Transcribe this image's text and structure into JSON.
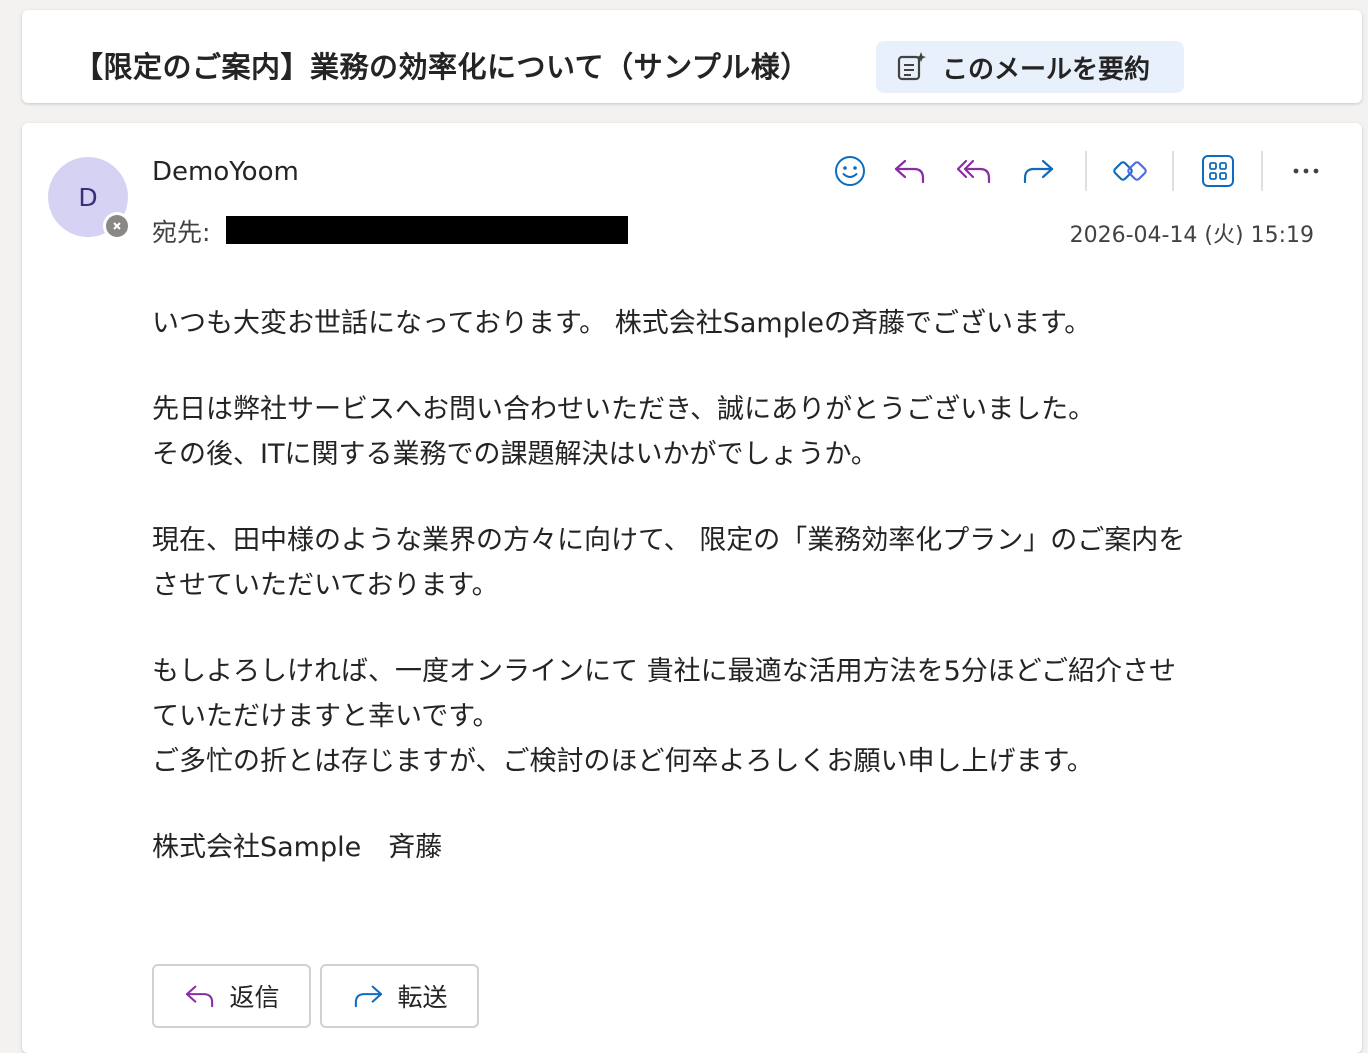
{
  "subject": {
    "title": "【限定のご案内】業務の効率化について（サンプル様）",
    "summarize_label": "このメールを要約"
  },
  "message": {
    "avatar_initial": "D",
    "sender": "DemoYoom",
    "to_label": "宛先:",
    "date": "2026-04-14 (火) 15:19",
    "body": [
      [
        "いつも大変お世話になっております。 株式会社Sampleの斉藤でございます。"
      ],
      [
        "先日は弊社サービスへお問い合わせいただき、誠にありがとうございました。",
        "その後、ITに関する業務での課題解決はいかがでしょうか。"
      ],
      [
        "現在、田中様のような業界の方々に向けて、 限定の「業務効率化プラン」のご案内を",
        "させていただいております。"
      ],
      [
        "もしよろしければ、一度オンラインにて 貴社に最適な活用方法を5分ほどご紹介させ",
        "ていただけますと幸いです。",
        "ご多忙の折とは存じますが、ご検討のほど何卒よろしくお願い申し上げます。"
      ],
      [
        "株式会社Sample　斉藤"
      ]
    ]
  },
  "toolbar": {
    "icons": [
      "emoji-icon",
      "reply-icon",
      "reply-all-icon",
      "forward-icon",
      "copilot-icon",
      "apps-icon",
      "more-icon"
    ]
  },
  "actions": {
    "reply_label": "返信",
    "forward_label": "転送"
  },
  "colors": {
    "accent_blue": "#0f6cbd",
    "reply_purple": "#8a2da5",
    "summarize_bg": "#e8f0fb",
    "avatar_bg": "#d6d2f3"
  }
}
